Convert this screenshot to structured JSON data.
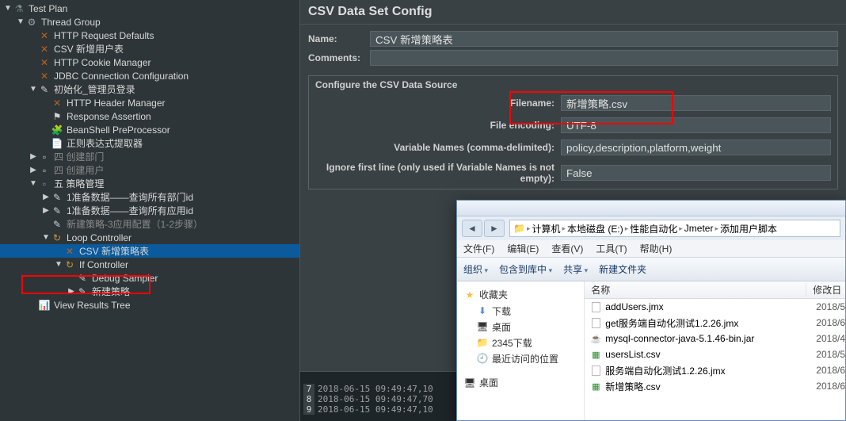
{
  "tree": {
    "n0": "Test Plan",
    "n1": "Thread Group",
    "n2": "HTTP Request Defaults",
    "n3": "CSV 新增用户表",
    "n4": "HTTP Cookie Manager",
    "n5": "JDBC Connection Configuration",
    "n6": "初始化_管理员登录",
    "n7": "HTTP Header Manager",
    "n8": "Response Assertion",
    "n9": "BeanShell PreProcessor",
    "n10": "正则表达式提取器",
    "n11": "四 创建部门",
    "n12": "四 创建用户",
    "n13": "五 策略管理",
    "n14": "1准备数据——查询所有部门id",
    "n15": "1准备数据——查询所有应用id",
    "n16": "新建策略-3应用配置（1-2步骤）",
    "n17": "Loop Controller",
    "n18": "CSV 新增策略表",
    "n19": "If Controller",
    "n20": "Debug Sampler",
    "n21": "新建策略",
    "n22": "View Results Tree"
  },
  "panel": {
    "title": "CSV Data Set Config",
    "name_label": "Name:",
    "name_value": "CSV 新增策略表",
    "comments_label": "Comments:",
    "fieldset_legend": "Configure the CSV Data Source",
    "filename_label": "Filename:",
    "filename_value": "新增策略.csv",
    "encoding_label": "File encoding:",
    "encoding_value": "UTF-8",
    "varnames_label": "Variable Names (comma-delimited):",
    "varnames_value": "policy,description,platform,weight",
    "ignore_label": "Ignore first line (only used if Variable Names is not empty):",
    "ignore_value": "False"
  },
  "log": {
    "l1": "2018-06-15 09:49:47,10",
    "l2": "2018-06-15 09:49:47,70",
    "l3": "2018-06-15 09:49:47,10"
  },
  "explorer": {
    "crumbs": {
      "c1": "计算机",
      "c2": "本地磁盘 (E:)",
      "c3": "性能自动化",
      "c4": "Jmeter",
      "c5": "添加用户脚本"
    },
    "menu": {
      "m1": "文件(F)",
      "m2": "编辑(E)",
      "m3": "查看(V)",
      "m4": "工具(T)",
      "m5": "帮助(H)"
    },
    "toolbar": {
      "t1": "组织",
      "t2": "包含到库中",
      "t3": "共享",
      "t4": "新建文件夹"
    },
    "side": {
      "favorites": "收藏夹",
      "downloads": "下载",
      "desktop": "桌面",
      "d2345": "2345下载",
      "recent": "最近访问的位置",
      "desktop2": "桌面"
    },
    "cols": {
      "name": "名称",
      "date": "修改日"
    },
    "files": {
      "f1": {
        "name": "addUsers.jmx",
        "date": "2018/5"
      },
      "f2": {
        "name": "get服务端自动化测试1.2.26.jmx",
        "date": "2018/6"
      },
      "f3": {
        "name": "mysql-connector-java-5.1.46-bin.jar",
        "date": "2018/4"
      },
      "f4": {
        "name": "usersList.csv",
        "date": "2018/5"
      },
      "f5": {
        "name": "服务端自动化测试1.2.26.jmx",
        "date": "2018/6"
      },
      "f6": {
        "name": "新增策略.csv",
        "date": "2018/6"
      }
    }
  }
}
